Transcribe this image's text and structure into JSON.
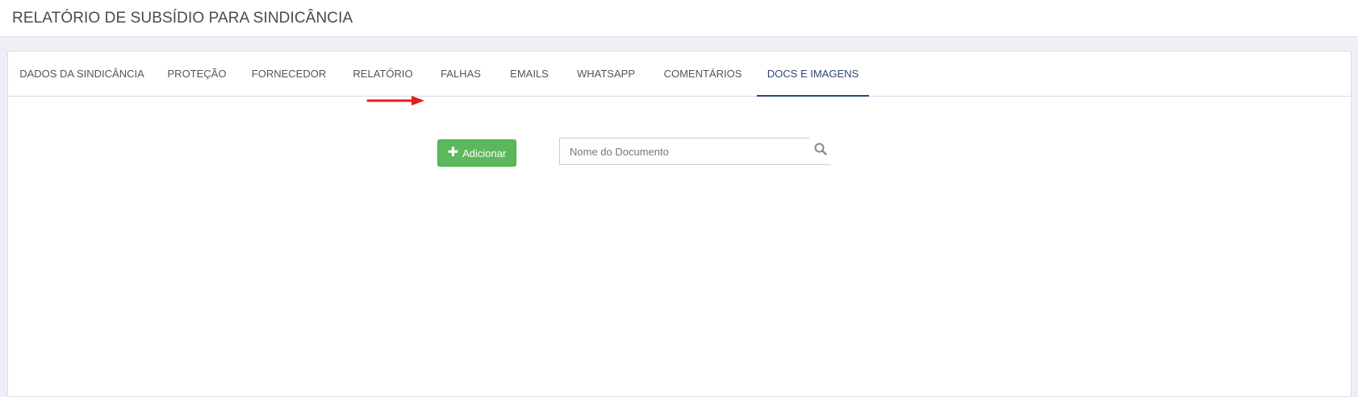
{
  "header": {
    "title": "RELATÓRIO DE SUBSÍDIO PARA SINDICÂNCIA"
  },
  "tabs": [
    {
      "label": "DADOS DA SINDICÂNCIA",
      "active": false
    },
    {
      "label": "PROTEÇÃO",
      "active": false
    },
    {
      "label": "FORNECEDOR",
      "active": false
    },
    {
      "label": "RELATÓRIO",
      "active": false
    },
    {
      "label": "FALHAS",
      "active": false
    },
    {
      "label": "EMAILS",
      "active": false
    },
    {
      "label": "WHATSAPP",
      "active": false
    },
    {
      "label": "COMENTÁRIOS",
      "active": false
    },
    {
      "label": "DOCS E IMAGENS",
      "active": true
    }
  ],
  "toolbar": {
    "add_label": "Adicionar",
    "add_icon": "plus-icon",
    "search_placeholder": "Nome do Documento",
    "search_value": "",
    "search_icon": "search-icon"
  },
  "colors": {
    "accent": "#2c4870",
    "add_button": "#5cb85c",
    "arrow": "#e31e1e"
  }
}
